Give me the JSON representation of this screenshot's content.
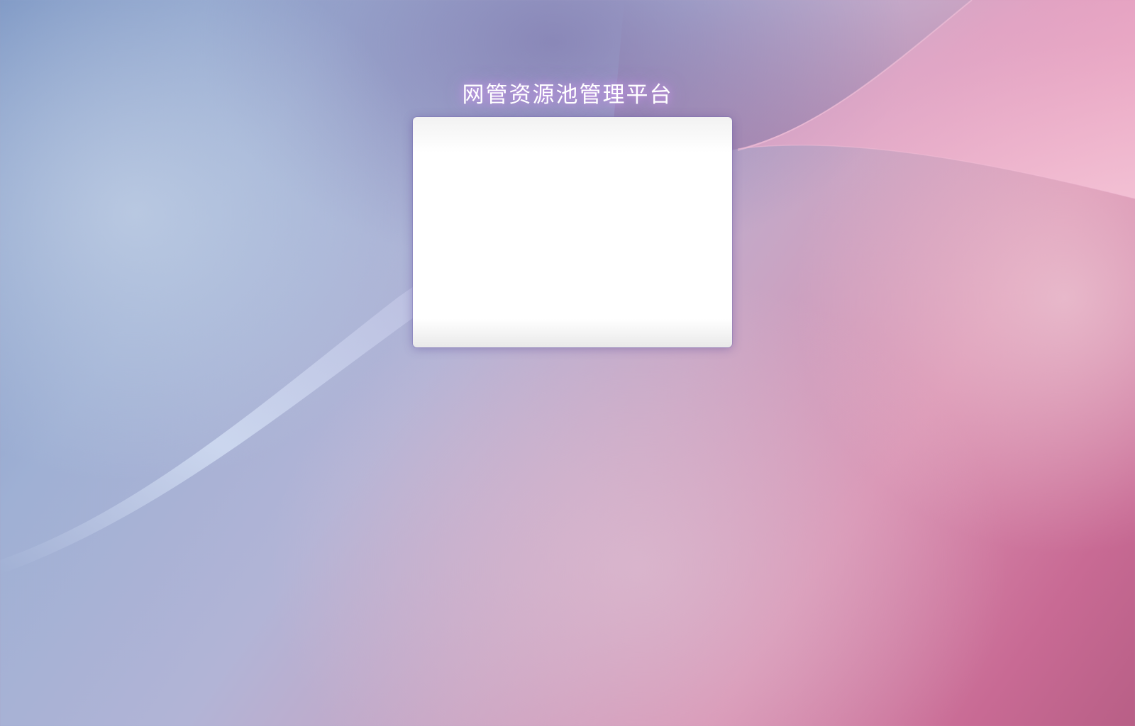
{
  "page": {
    "title": "网管资源池管理平台"
  },
  "login_panel": {
    "state": "blank"
  },
  "colors": {
    "background_blue": "#7d97c4",
    "background_pink": "#c86a94",
    "panel_background": "#ffffff",
    "title_text": "#ffffff",
    "title_glow": "#d296f0"
  }
}
